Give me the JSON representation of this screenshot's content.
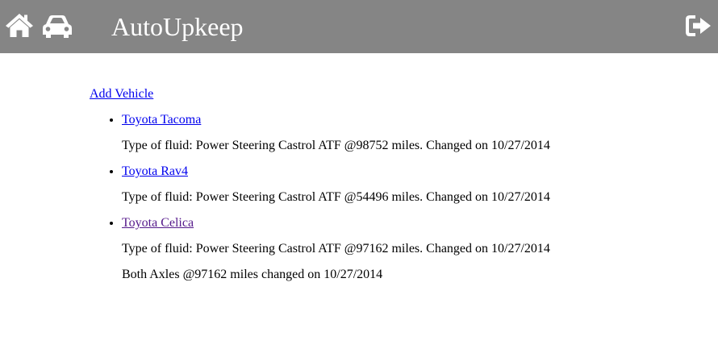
{
  "header": {
    "title": "AutoUpkeep",
    "background_color": "#858585",
    "home_icon": "home-icon",
    "car_icon": "car-icon",
    "signout_icon": "sign-out-icon"
  },
  "main": {
    "add_vehicle_label": "Add Vehicle",
    "vehicles": [
      {
        "name": "Toyota Tacoma",
        "records": [
          "Type of fluid: Power Steering Castrol ATF @98752 miles. Changed on 10/27/2014"
        ]
      },
      {
        "name": "Toyota Rav4",
        "records": [
          "Type of fluid: Power Steering Castrol ATF @54496 miles. Changed on 10/27/2014"
        ]
      },
      {
        "name": "Toyota Celica",
        "records": [
          "Type of fluid: Power Steering Castrol ATF @97162 miles. Changed on 10/27/2014",
          "Both Axles @97162 miles changed on 10/27/2014"
        ]
      }
    ]
  },
  "colors": {
    "link": "#0000ee",
    "visited_link": "#551a8b"
  }
}
